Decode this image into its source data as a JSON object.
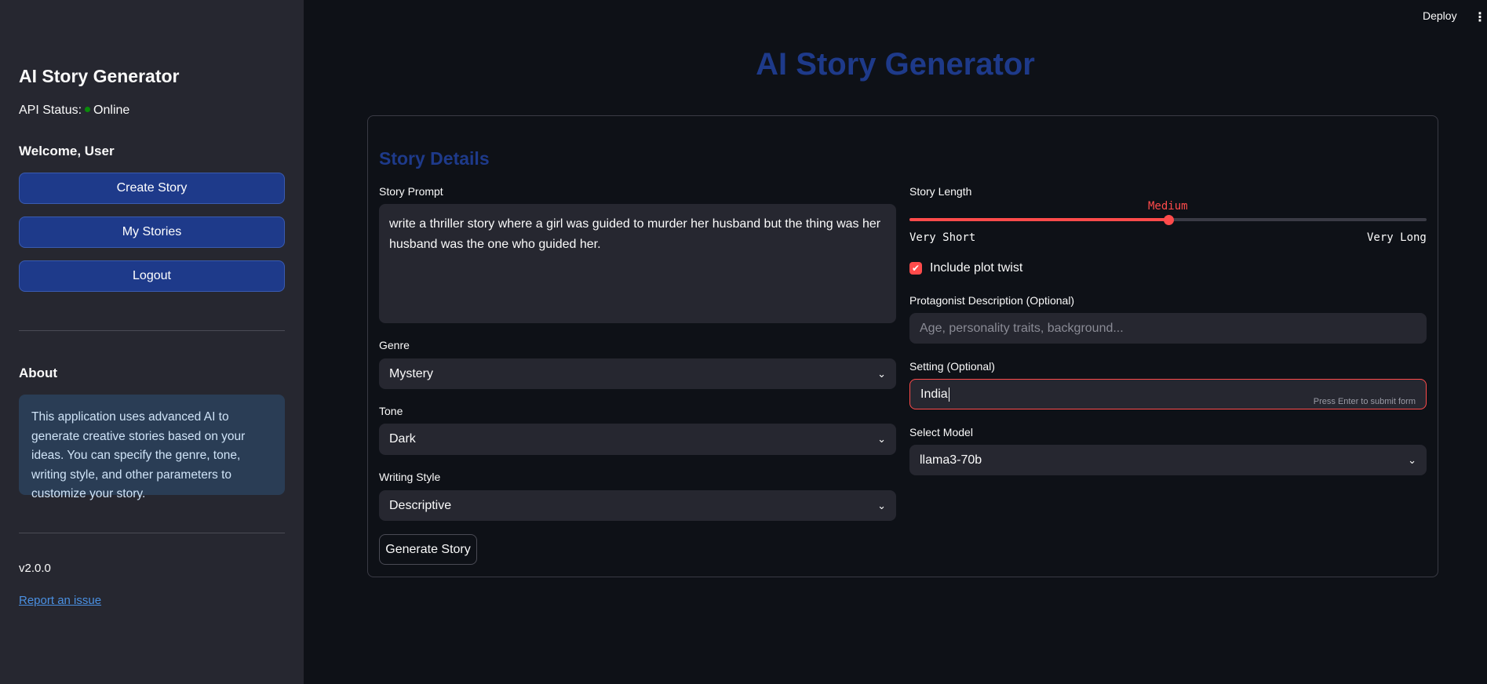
{
  "topbar": {
    "deploy_label": "Deploy",
    "menu_icon": "kebab-icon"
  },
  "sidebar": {
    "title": "AI Story Generator",
    "api_status_label": "API Status:",
    "api_status_value": "Online",
    "api_status_color": "#0a8a0a",
    "welcome": "Welcome, User",
    "buttons": [
      {
        "label": "Create Story"
      },
      {
        "label": "My Stories"
      },
      {
        "label": "Logout"
      }
    ],
    "about_heading": "About",
    "about_text": "This application uses advanced AI to generate creative stories based on your ideas. You can specify the genre, tone, writing style, and other parameters to customize your story.",
    "version": "v2.0.0",
    "report_link": "Report an issue"
  },
  "main": {
    "title": "AI Story Generator",
    "section_title": "Story Details",
    "story_prompt": {
      "label": "Story Prompt",
      "value": "write a thriller story where a girl was guided to murder her husband but the thing was her husband was the one who guided her."
    },
    "genre": {
      "label": "Genre",
      "value": "Mystery"
    },
    "tone": {
      "label": "Tone",
      "value": "Dark"
    },
    "writing_style": {
      "label": "Writing Style",
      "value": "Descriptive"
    },
    "generate_label": "Generate Story",
    "story_length": {
      "label": "Story Length",
      "value": "Medium",
      "min_label": "Very Short",
      "max_label": "Very Long",
      "position_fraction": 0.5
    },
    "plot_twist": {
      "label": "Include plot twist",
      "checked": true
    },
    "protagonist": {
      "label": "Protagonist Description (Optional)",
      "placeholder": "Age, personality traits, background..."
    },
    "setting": {
      "label": "Setting (Optional)",
      "value": "India",
      "hint": "Press Enter to submit form"
    },
    "model": {
      "label": "Select Model",
      "value": "llama3-70b"
    },
    "accent_color": "#ff4b4b",
    "brand_color": "#1e3a8a"
  }
}
